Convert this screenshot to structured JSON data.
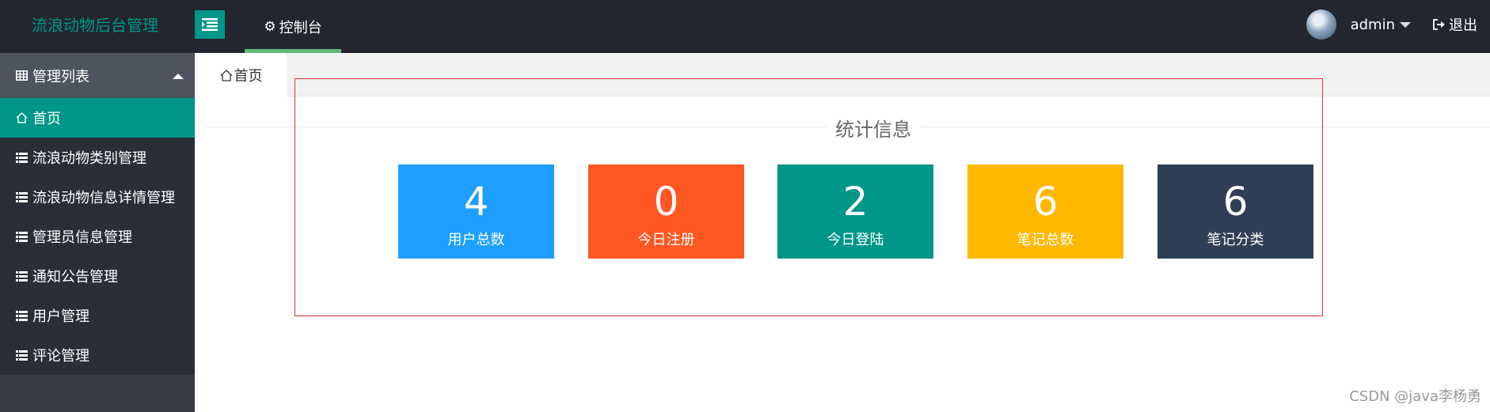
{
  "header": {
    "logo_text": "流浪动物后台管理",
    "menu_toggle_icon": "menu-indent-icon",
    "console_label": "控制台",
    "console_icon": "gear-icon",
    "user_name": "admin",
    "logout_label": "退出"
  },
  "sidebar": {
    "group_title": "管理列表",
    "group_icon": "table-icon",
    "items": [
      {
        "label": "首页",
        "icon": "home-icon",
        "active": true
      },
      {
        "label": "流浪动物类别管理",
        "icon": "list-icon"
      },
      {
        "label": "流浪动物信息详情管理",
        "icon": "list-icon"
      },
      {
        "label": "管理员信息管理",
        "icon": "list-icon"
      },
      {
        "label": "通知公告管理",
        "icon": "list-icon"
      },
      {
        "label": "用户管理",
        "icon": "list-icon"
      },
      {
        "label": "评论管理",
        "icon": "list-icon"
      }
    ]
  },
  "tabs": {
    "home_label": "首页"
  },
  "stats": {
    "title": "统计信息",
    "cards": [
      {
        "value": "4",
        "label": "用户总数",
        "color": "#1e9fff"
      },
      {
        "value": "0",
        "label": "今日注册",
        "color": "#ff5722"
      },
      {
        "value": "2",
        "label": "今日登陆",
        "color": "#009688"
      },
      {
        "value": "6",
        "label": "笔记总数",
        "color": "#ffb800"
      },
      {
        "value": "6",
        "label": "笔记分类",
        "color": "#2f4056"
      }
    ]
  },
  "watermark": "CSDN @java李杨勇",
  "colors": {
    "header_bg": "#23262e",
    "accent": "#009688",
    "sidebar_bg": "#393d49",
    "highlight_frame": "#e0303a"
  }
}
